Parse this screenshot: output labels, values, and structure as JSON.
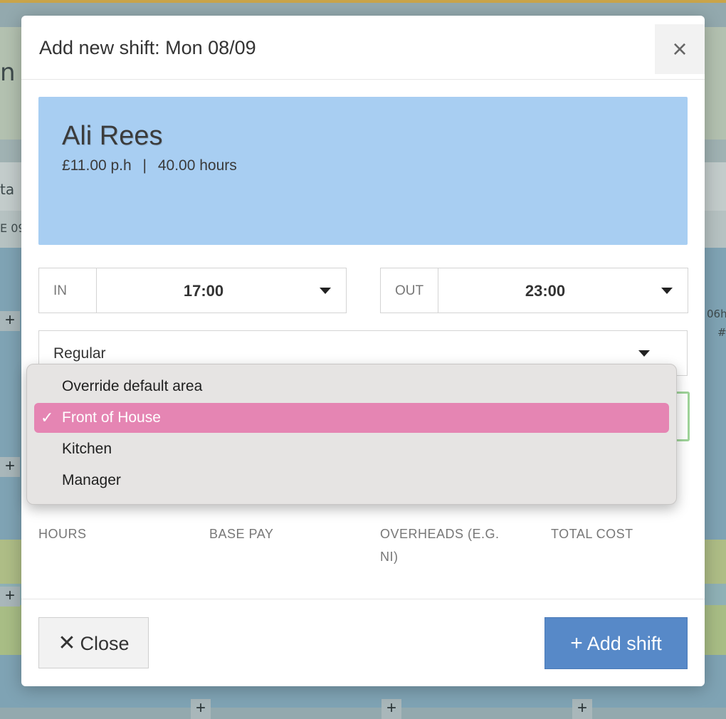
{
  "background": {
    "fragments": [
      "n",
      "ta",
      "E 09",
      "06h",
      "#"
    ]
  },
  "modal": {
    "title": "Add new shift: Mon 08/09",
    "close_icon": "×",
    "employee": {
      "name": "Ali Rees",
      "rate": "£11.00 p.h",
      "separator": "|",
      "hours": "40.00 hours",
      "card_color": "#a8cef2"
    },
    "time_in": {
      "label": "IN",
      "value": "17:00"
    },
    "time_out": {
      "label": "OUT",
      "value": "23:00"
    },
    "shift_type": {
      "value": "Regular"
    },
    "area_dropdown": {
      "options": [
        {
          "label": "Override default area",
          "selected": false
        },
        {
          "label": "Front of House",
          "selected": true
        },
        {
          "label": "Kitchen",
          "selected": false
        },
        {
          "label": "Manager",
          "selected": false
        }
      ],
      "check_mark": "✓",
      "highlight_color": "#e585b3"
    },
    "stats": {
      "hours": "HOURS",
      "base_pay": "BASE PAY",
      "overheads_line1": "OVERHEADS (E.G.",
      "overheads_line2": "NI)",
      "total_cost": "TOTAL COST"
    },
    "footer": {
      "close_icon": "✕",
      "close_label": "Close",
      "add_icon": "+",
      "add_label": "Add shift",
      "add_color": "#5789c8"
    }
  }
}
